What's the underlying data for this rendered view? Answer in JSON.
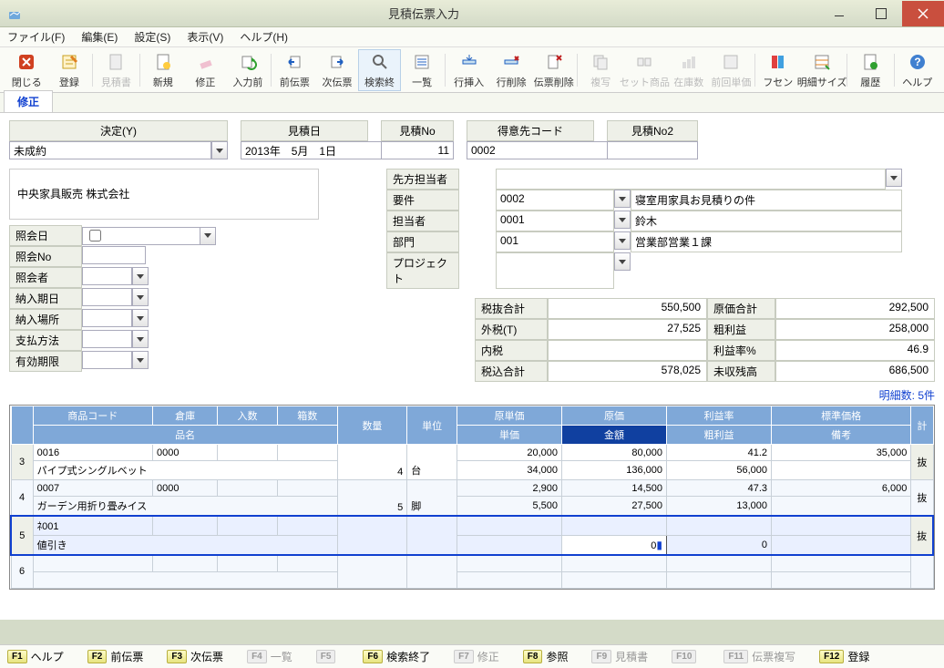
{
  "window": {
    "title": "見積伝票入力"
  },
  "menu": {
    "file": "ファイル(F)",
    "edit": "編集(E)",
    "settings": "設定(S)",
    "view": "表示(V)",
    "help": "ヘルプ(H)"
  },
  "toolbar": {
    "close": "閉じる",
    "register": "登録",
    "estimate_sheet": "見積書",
    "new": "新規",
    "correct": "修正",
    "before_input": "入力前",
    "prev": "前伝票",
    "next": "次伝票",
    "search_end": "検索終",
    "list": "一覧",
    "row_insert": "行挿入",
    "row_delete": "行削除",
    "slip_delete": "伝票削除",
    "copy": "複写",
    "set_item": "セット商品",
    "stock": "在庫数",
    "prev_price": "前回単価",
    "fusen": "フセン",
    "detail_size": "明細サイズ",
    "history": "履歴",
    "help": "ヘルプ"
  },
  "tab": {
    "correct": "修正"
  },
  "header": {
    "decision_label": "決定(Y)",
    "decision_value": "未成約",
    "est_date_label": "見積日",
    "est_date_value": "2013年　5月　1日",
    "est_no_label": "見積No",
    "est_no_value": "11",
    "cust_code_label": "得意先コード",
    "cust_code_value": "0002",
    "est_no2_label": "見積No2",
    "est_no2_value": "",
    "company": "中央家具販売 株式会社",
    "inquiry_date_label": "照会日",
    "inquiry_no_label": "照会No",
    "inquirer_label": "照会者",
    "delivery_date_label": "納入期日",
    "delivery_place_label": "納入場所",
    "payment_label": "支払方法",
    "validity_label": "有効期限"
  },
  "right": {
    "contact_label": "先方担当者",
    "subject_label": "要件",
    "subject_code": "0002",
    "subject_text": "寝室用家具お見積りの件",
    "person_label": "担当者",
    "person_code": "0001",
    "person_text": "鈴木",
    "dept_label": "部門",
    "dept_code": "001",
    "dept_text": "営業部営業１課",
    "project_label": "プロジェクト"
  },
  "totals": {
    "subtotal_label": "税抜合計",
    "subtotal": "550,500",
    "ext_tax_label": "外税(T)",
    "ext_tax": "27,525",
    "int_tax_label": "内税",
    "int_tax": "",
    "grand_label": "税込合計",
    "grand": "578,025",
    "cost_total_label": "原価合計",
    "cost_total": "292,500",
    "gross_label": "粗利益",
    "gross": "258,000",
    "margin_label": "利益率%",
    "margin": "46.9",
    "unrecovered_label": "未収残高",
    "unrecovered": "686,500"
  },
  "grid": {
    "line_count": "明細数: 5件",
    "headers": {
      "item_code": "商品コード",
      "warehouse": "倉庫",
      "in_qty": "入数",
      "box_qty": "箱数",
      "qty": "数量",
      "unit": "単位",
      "unit_cost": "原単価",
      "cost": "原価",
      "margin_rate": "利益率",
      "std_price": "標準価格",
      "item_name": "品名",
      "unit_price": "単価",
      "amount": "金額",
      "gross_profit": "粗利益",
      "remarks": "備考",
      "total_col": "計"
    },
    "rows": [
      {
        "no": "3",
        "code": "0016",
        "whs": "0000",
        "in_qty": "",
        "box": "",
        "qty": "4",
        "unit": "台",
        "ucost": "20,000",
        "cost": "80,000",
        "mrate": "41.2",
        "std": "35,000",
        "name": "パイプ式シングルベット",
        "uprice": "34,000",
        "amount": "136,000",
        "gp": "56,000",
        "remarks": "",
        "suffix": "抜"
      },
      {
        "no": "4",
        "code": "0007",
        "whs": "0000",
        "in_qty": "",
        "box": "",
        "qty": "5",
        "unit": "脚",
        "ucost": "2,900",
        "cost": "14,500",
        "mrate": "47.3",
        "std": "6,000",
        "name": "ガーデン用折り畳みイス",
        "uprice": "5,500",
        "amount": "27,500",
        "gp": "13,000",
        "remarks": "",
        "suffix": "抜"
      },
      {
        "no": "5",
        "code": "ﾈ001",
        "whs": "",
        "in_qty": "",
        "box": "",
        "qty": "",
        "unit": "",
        "ucost": "",
        "cost": "",
        "mrate": "",
        "std": "",
        "name": "値引き",
        "uprice": "",
        "amount": "0",
        "gp": "0",
        "remarks": "",
        "suffix": "抜",
        "active": true
      },
      {
        "no": "6",
        "code": "",
        "whs": "",
        "in_qty": "",
        "box": "",
        "qty": "",
        "unit": "",
        "ucost": "",
        "cost": "",
        "mrate": "",
        "std": "",
        "name": "",
        "uprice": "",
        "amount": "",
        "gp": "",
        "remarks": "",
        "suffix": ""
      }
    ]
  },
  "fkeys": {
    "f1": "ヘルプ",
    "f2": "前伝票",
    "f3": "次伝票",
    "f4": "一覧",
    "f5": "",
    "f6": "検索終了",
    "f7": "修正",
    "f8": "参照",
    "f9": "見積書",
    "f10": "",
    "f11": "伝票複写",
    "f12": "登録"
  }
}
